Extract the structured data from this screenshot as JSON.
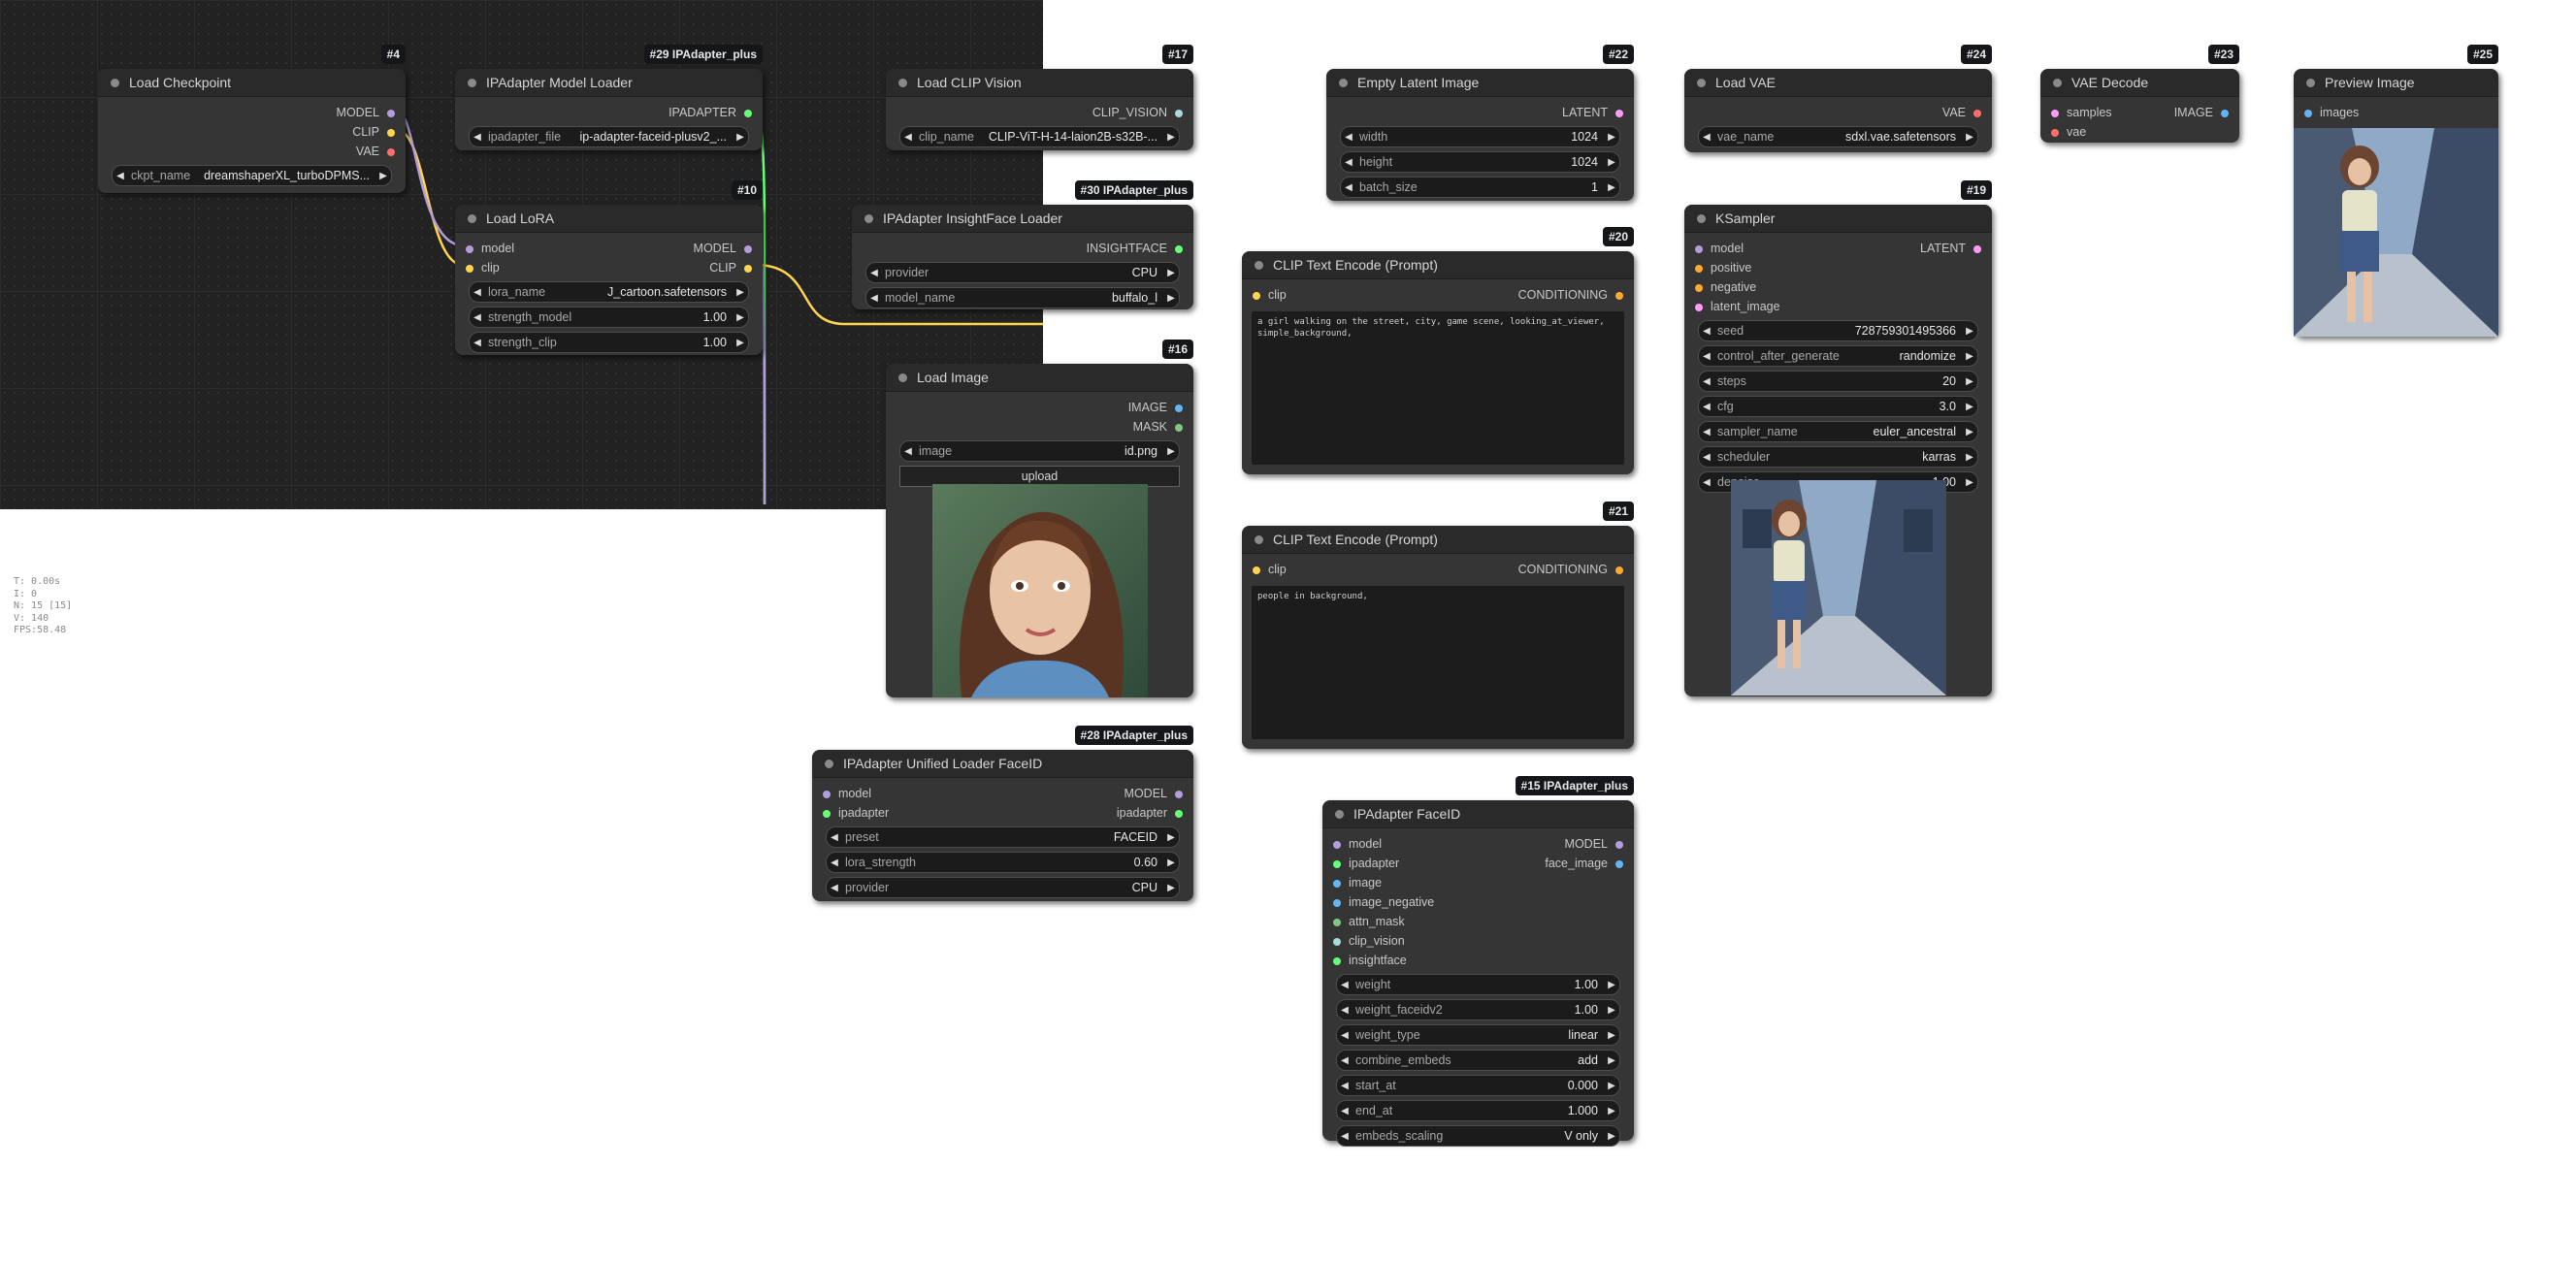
{
  "stats": [
    "T: 0.00s",
    "I: 0",
    "N: 15 [15]",
    "V: 140",
    "FPS:58.48"
  ],
  "colors": {
    "canvas_bg": "#222222",
    "node_bg": "#353535",
    "title_bg": "#2a2a2a",
    "badge_bg": "#14161a",
    "model": "#b39ddb",
    "clip": "#ffd54f",
    "vae": "#ff6e6e",
    "conditioning": "#ffa931",
    "latent": "#ff9cf9",
    "image": "#64b5f6",
    "ipadapter": "#66ff77",
    "insightface": "#66ff77",
    "clip_vision": "#a8dadc",
    "mask": "#81c784"
  },
  "nodes": {
    "n4": {
      "id": "#4",
      "title": "Load Checkpoint",
      "outputs": [
        "MODEL",
        "CLIP",
        "VAE"
      ],
      "widgets": [
        {
          "name": "ckpt_name",
          "value": "dreamshaperXL_turboDPMS..."
        }
      ]
    },
    "n29": {
      "id": "#29 IPAdapter_plus",
      "title": "IPAdapter Model Loader",
      "outputs": [
        "IPADAPTER"
      ],
      "widgets": [
        {
          "name": "ipadapter_file",
          "value": "ip-adapter-faceid-plusv2_..."
        }
      ]
    },
    "n10": {
      "id": "#10",
      "title": "Load LoRA",
      "inputs": [
        "model",
        "clip"
      ],
      "outputs": [
        "MODEL",
        "CLIP"
      ],
      "widgets": [
        {
          "name": "lora_name",
          "value": "J_cartoon.safetensors"
        },
        {
          "name": "strength_model",
          "value": "1.00"
        },
        {
          "name": "strength_clip",
          "value": "1.00"
        }
      ]
    },
    "n17": {
      "id": "#17",
      "title": "Load CLIP Vision",
      "outputs": [
        "CLIP_VISION"
      ],
      "widgets": [
        {
          "name": "clip_name",
          "value": "CLIP-ViT-H-14-laion2B-s32B-..."
        }
      ]
    },
    "n30": {
      "id": "#30 IPAdapter_plus",
      "title": "IPAdapter InsightFace Loader",
      "outputs": [
        "INSIGHTFACE"
      ],
      "widgets": [
        {
          "name": "provider",
          "value": "CPU"
        },
        {
          "name": "model_name",
          "value": "buffalo_l"
        }
      ]
    },
    "n16": {
      "id": "#16",
      "title": "Load Image",
      "outputs": [
        "IMAGE",
        "MASK"
      ],
      "widgets": [
        {
          "name": "image",
          "value": "id.png"
        }
      ],
      "button": "upload"
    },
    "n28": {
      "id": "#28 IPAdapter_plus",
      "title": "IPAdapter Unified Loader FaceID",
      "inputs": [
        "model",
        "ipadapter"
      ],
      "outputs": [
        "MODEL",
        "ipadapter"
      ],
      "widgets": [
        {
          "name": "preset",
          "value": "FACEID"
        },
        {
          "name": "lora_strength",
          "value": "0.60"
        },
        {
          "name": "provider",
          "value": "CPU"
        }
      ]
    },
    "n22": {
      "id": "#22",
      "title": "Empty Latent Image",
      "outputs": [
        "LATENT"
      ],
      "widgets": [
        {
          "name": "width",
          "value": "1024"
        },
        {
          "name": "height",
          "value": "1024"
        },
        {
          "name": "batch_size",
          "value": "1"
        }
      ]
    },
    "n20": {
      "id": "#20",
      "title": "CLIP Text Encode (Prompt)",
      "inputs": [
        "clip"
      ],
      "outputs": [
        "CONDITIONING"
      ],
      "text": "a girl walking on the street, city, game scene, looking_at_viewer,\nsimple_background,"
    },
    "n21": {
      "id": "#21",
      "title": "CLIP Text Encode (Prompt)",
      "inputs": [
        "clip"
      ],
      "outputs": [
        "CONDITIONING"
      ],
      "text": "people in background,"
    },
    "n15": {
      "id": "#15 IPAdapter_plus",
      "title": "IPAdapter FaceID",
      "inputs": [
        "model",
        "ipadapter",
        "image",
        "image_negative",
        "attn_mask",
        "clip_vision",
        "insightface"
      ],
      "outputs": [
        "MODEL",
        "face_image"
      ],
      "widgets": [
        {
          "name": "weight",
          "value": "1.00"
        },
        {
          "name": "weight_faceidv2",
          "value": "1.00"
        },
        {
          "name": "weight_type",
          "value": "linear"
        },
        {
          "name": "combine_embeds",
          "value": "add"
        },
        {
          "name": "start_at",
          "value": "0.000"
        },
        {
          "name": "end_at",
          "value": "1.000"
        },
        {
          "name": "embeds_scaling",
          "value": "V only"
        }
      ]
    },
    "n24": {
      "id": "#24",
      "title": "Load VAE",
      "outputs": [
        "VAE"
      ],
      "widgets": [
        {
          "name": "vae_name",
          "value": "sdxl.vae.safetensors"
        }
      ]
    },
    "n19": {
      "id": "#19",
      "title": "KSampler",
      "inputs": [
        "model",
        "positive",
        "negative",
        "latent_image"
      ],
      "outputs": [
        "LATENT"
      ],
      "widgets": [
        {
          "name": "seed",
          "value": "728759301495366"
        },
        {
          "name": "control_after_generate",
          "value": "randomize"
        },
        {
          "name": "steps",
          "value": "20"
        },
        {
          "name": "cfg",
          "value": "3.0"
        },
        {
          "name": "sampler_name",
          "value": "euler_ancestral"
        },
        {
          "name": "scheduler",
          "value": "karras"
        },
        {
          "name": "denoise",
          "value": "1.00"
        }
      ]
    },
    "n23": {
      "id": "#23",
      "title": "VAE Decode",
      "inputs": [
        "samples",
        "vae"
      ],
      "outputs": [
        "IMAGE"
      ]
    },
    "n25": {
      "id": "#25",
      "title": "Preview Image",
      "inputs": [
        "images"
      ]
    }
  }
}
